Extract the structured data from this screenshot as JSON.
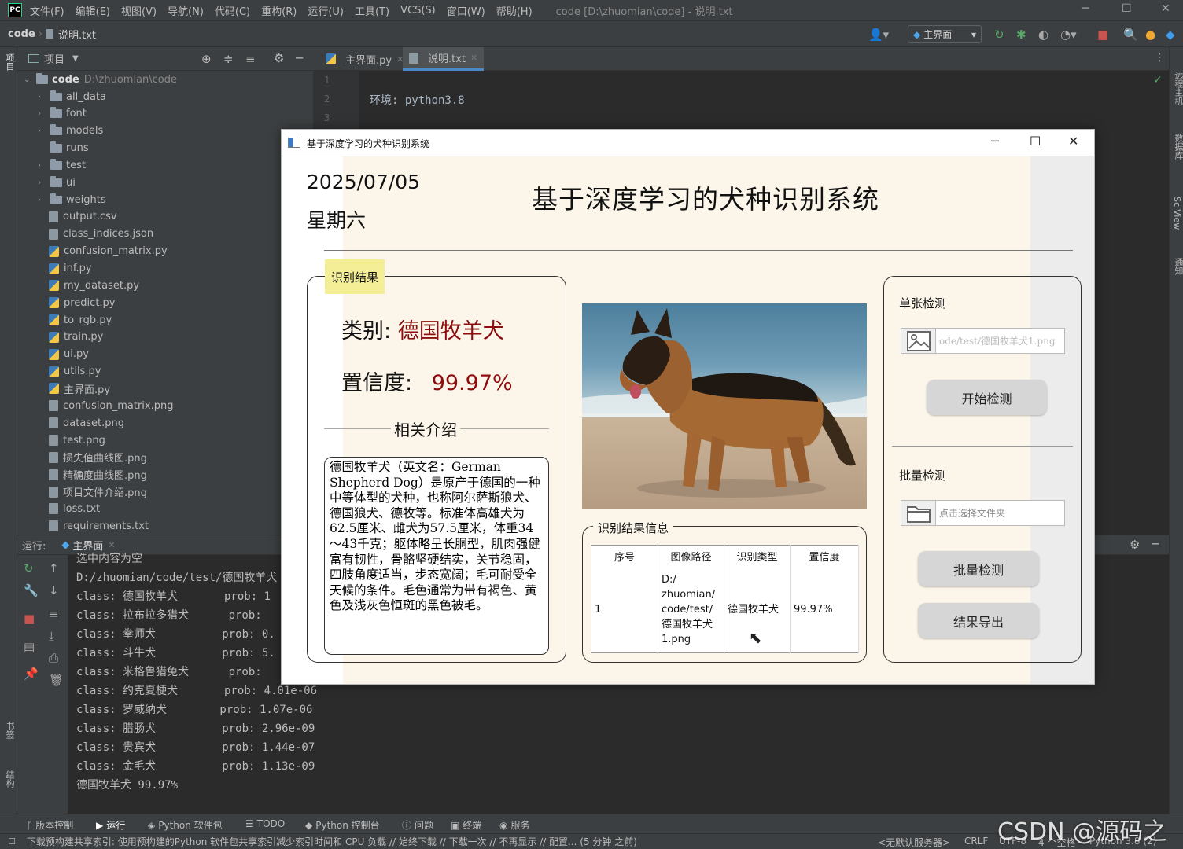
{
  "ide": {
    "logo": "PC",
    "menu": [
      "文件(F)",
      "编辑(E)",
      "视图(V)",
      "导航(N)",
      "代码(C)",
      "重构(R)",
      "运行(U)",
      "工具(T)",
      "VCS(S)",
      "窗口(W)",
      "帮助(H)"
    ],
    "window_title": "code [D:\\zhuomian\\code] - 说明.txt",
    "breadcrumb_root": "code",
    "breadcrumb_file": "说明.txt",
    "run_config": "主界面",
    "left_strip_label": "项目",
    "left_strip_bottom": [
      "书签",
      "结构"
    ],
    "right_strip": [
      "远程主机",
      "数据库",
      "SciView",
      "通知"
    ]
  },
  "project": {
    "header": "项目",
    "root_name": "code",
    "root_path": "D:\\zhuomian\\code",
    "items": [
      {
        "name": "all_data",
        "kind": "folder",
        "expandable": true
      },
      {
        "name": "font",
        "kind": "folder",
        "expandable": true
      },
      {
        "name": "models",
        "kind": "folder",
        "expandable": true
      },
      {
        "name": "runs",
        "kind": "folder",
        "expandable": false
      },
      {
        "name": "test",
        "kind": "folder",
        "expandable": true
      },
      {
        "name": "ui",
        "kind": "folder",
        "expandable": true
      },
      {
        "name": "weights",
        "kind": "folder",
        "expandable": true
      },
      {
        "name": "output.csv",
        "kind": "file"
      },
      {
        "name": "class_indices.json",
        "kind": "file"
      },
      {
        "name": "confusion_matrix.py",
        "kind": "py"
      },
      {
        "name": "inf.py",
        "kind": "py"
      },
      {
        "name": "my_dataset.py",
        "kind": "py"
      },
      {
        "name": "predict.py",
        "kind": "py"
      },
      {
        "name": "to_rgb.py",
        "kind": "py"
      },
      {
        "name": "train.py",
        "kind": "py"
      },
      {
        "name": "ui.py",
        "kind": "py"
      },
      {
        "name": "utils.py",
        "kind": "py"
      },
      {
        "name": "主界面.py",
        "kind": "py"
      },
      {
        "name": "confusion_matrix.png",
        "kind": "file"
      },
      {
        "name": "dataset.png",
        "kind": "file"
      },
      {
        "name": "test.png",
        "kind": "file"
      },
      {
        "name": "损失值曲线图.png",
        "kind": "file"
      },
      {
        "name": "精确度曲线图.png",
        "kind": "file"
      },
      {
        "name": "项目文件介绍.png",
        "kind": "file"
      },
      {
        "name": "loss.txt",
        "kind": "file"
      },
      {
        "name": "requirements.txt",
        "kind": "file"
      }
    ]
  },
  "editor": {
    "tabs": [
      "主界面.py",
      "说明.txt"
    ],
    "active_tab": 1,
    "lines": [
      {
        "no": "1",
        "text": ""
      },
      {
        "no": "2",
        "text": "环境: python3.8"
      },
      {
        "no": "3",
        "text": ""
      }
    ]
  },
  "run_panel": {
    "label": "运行:",
    "tab": "主界面",
    "lines": [
      "选中内容为空",
      "D:/zhuomian/code/test/德国牧羊犬",
      "class: 德国牧羊犬       prob: 1",
      "class: 拉布拉多猎犬      prob: ",
      "class: 拳师犬          prob: 0.",
      "class: 斗牛犬          prob: 5.",
      "class: 米格鲁猎兔犬      prob: ",
      "class: 约克夏梗犬       prob: 4.01e-06",
      "class: 罗威纳犬        prob: 1.07e-06",
      "class: 腊肠犬          prob: 2.96e-09",
      "class: 贵宾犬          prob: 1.44e-07",
      "class: 金毛犬          prob: 1.13e-09",
      "德国牧羊犬 99.97%"
    ]
  },
  "tool_tabs": [
    "版本控制",
    "运行",
    "Python 软件包",
    "TODO",
    "Python 控制台",
    "问题",
    "终端",
    "服务"
  ],
  "status": {
    "message": "下载预构建共享索引: 使用预构建的Python 软件包共享索引减少索引时间和 CPU 负载 // 始终下载 // 下载一次 // 不再显示 // 配置... (5 分钟 之前)",
    "server": "<无默认服务器>",
    "line_sep": "CRLF",
    "encoding": "UTF-8",
    "indent": "4 个空格",
    "interpreter": "Python 3.8 (2)"
  },
  "watermark": "CSDN @源码之家",
  "app": {
    "window_title": "基于深度学习的犬种识别系统",
    "date": "2025/07/05",
    "weekday": "星期六",
    "title": "基于深度学习的犬种识别系统",
    "result_group": "识别结果",
    "category_label": "类别:",
    "category_value": "德国牧羊犬",
    "confidence_label": "置信度:",
    "confidence_value": "99.97%",
    "intro_title": "相关介绍",
    "intro_text": "德国牧羊犬（英文名：German Shepherd Dog）是原产于德国的一种中等体型的犬种，也称阿尔萨斯狼犬、德国狼犬、德牧等。标准体高雄犬为62.5厘米、雌犬为57.5厘米，体重34～43千克；躯体略呈长胴型，肌肉强健富有韧性，骨骼坚硬结实，关节稳固，四肢角度适当，步态宽阔；毛可耐受全天候的条件。毛色通常为带有褐色、黄色及浅灰色恒斑的黑色被毛。",
    "info_group": "识别结果信息",
    "table": {
      "headers": [
        "序号",
        "图像路径",
        "识别类型",
        "置信度"
      ],
      "rows": [
        [
          "1",
          "D:/\nzhuomian/\ncode/test/\n德国牧羊犬\n1.png",
          "德国牧羊犬",
          "99.97%"
        ]
      ]
    },
    "single_title": "单张检测",
    "single_path": "ode/test/德国牧羊犬1.png",
    "start_button": "开始检测",
    "batch_title": "批量检测",
    "batch_placeholder": "点击选择文件夹",
    "batch_button": "批量检测",
    "export_button": "结果导出"
  }
}
